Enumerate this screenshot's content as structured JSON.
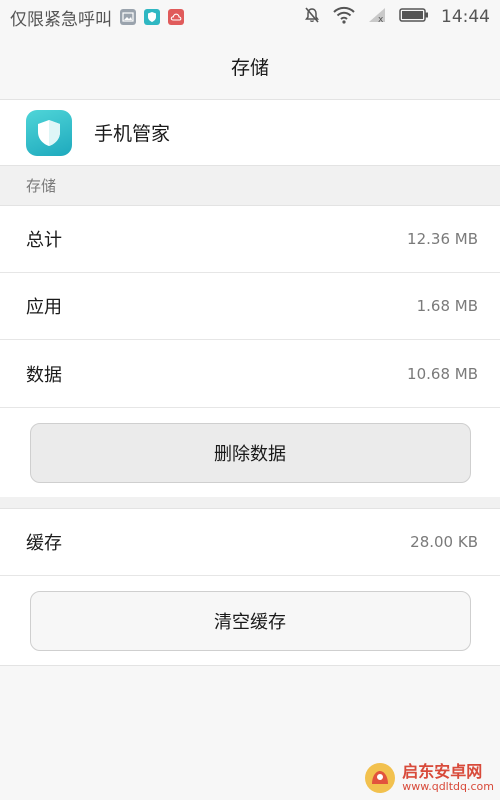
{
  "status_bar": {
    "left_text": "仅限紧急呼叫",
    "time": "14:44"
  },
  "header": {
    "title": "存储"
  },
  "app": {
    "name": "手机管家"
  },
  "section": {
    "title": "存储"
  },
  "storage": {
    "items": [
      {
        "label": "总计",
        "value": "12.36 MB"
      },
      {
        "label": "应用",
        "value": "1.68 MB"
      },
      {
        "label": "数据",
        "value": "10.68 MB"
      }
    ],
    "delete_button": "删除数据"
  },
  "cache": {
    "label": "缓存",
    "value": "28.00 KB",
    "clear_button": "清空缓存"
  },
  "watermark": {
    "name": "启东安卓网",
    "url": "www.qdltdq.com"
  },
  "colors": {
    "accent_teal": "#2fb7c2",
    "watermark_red": "#d84a3a"
  }
}
